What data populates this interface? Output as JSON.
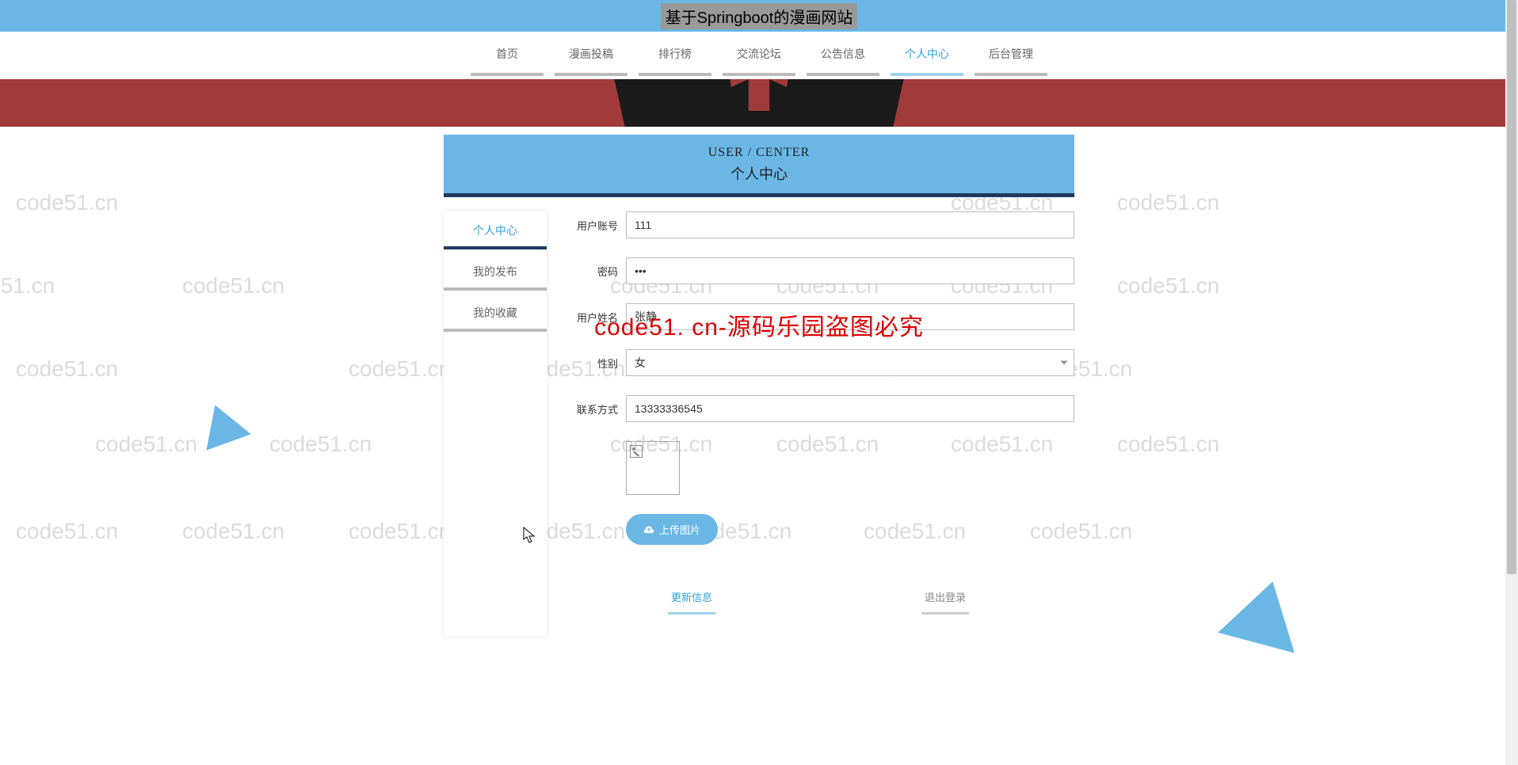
{
  "header": {
    "title": "基于Springboot的漫画网站"
  },
  "nav": {
    "items": [
      {
        "label": "首页"
      },
      {
        "label": "漫画投稿"
      },
      {
        "label": "排行榜"
      },
      {
        "label": "交流论坛"
      },
      {
        "label": "公告信息"
      },
      {
        "label": "个人中心"
      },
      {
        "label": "后台管理"
      }
    ],
    "active_index": 5
  },
  "panel": {
    "title_en": "USER / CENTER",
    "title_cn": "个人中心"
  },
  "side_menu": {
    "items": [
      {
        "label": "个人中心"
      },
      {
        "label": "我的发布"
      },
      {
        "label": "我的收藏"
      }
    ],
    "active_index": 0
  },
  "form": {
    "fields": {
      "username": {
        "label": "用户账号",
        "value": "111"
      },
      "password": {
        "label": "密码",
        "value": "•••"
      },
      "nickname": {
        "label": "用户姓名",
        "value": "张静"
      },
      "gender": {
        "label": "性别",
        "value": "女"
      },
      "contact": {
        "label": "联系方式",
        "value": "13333336545"
      }
    },
    "upload_label": "上传图片",
    "actions": {
      "update": "更新信息",
      "logout": "退出登录"
    }
  },
  "watermark": {
    "text": "code51.cn",
    "overlay": "code51. cn-源码乐园盗图必究"
  }
}
